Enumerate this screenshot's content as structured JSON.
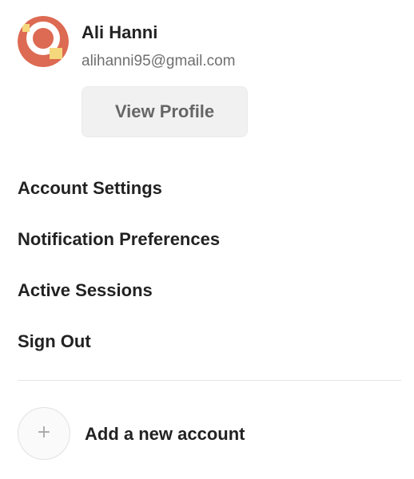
{
  "user": {
    "name": "Ali Hanni",
    "email": "alihanni95@gmail.com",
    "avatar_icon": "avatar-logo-icon",
    "avatar_colors": {
      "primary": "#dd6a52",
      "accent": "#f5d77c",
      "ring": "#ffffff"
    }
  },
  "profile_button": {
    "label": "View Profile"
  },
  "menu": {
    "items": [
      {
        "label": "Account Settings"
      },
      {
        "label": "Notification Preferences"
      },
      {
        "label": "Active Sessions"
      },
      {
        "label": "Sign Out"
      }
    ]
  },
  "add_account": {
    "icon": "plus-icon",
    "icon_glyph": "+",
    "label": "Add a new account"
  }
}
